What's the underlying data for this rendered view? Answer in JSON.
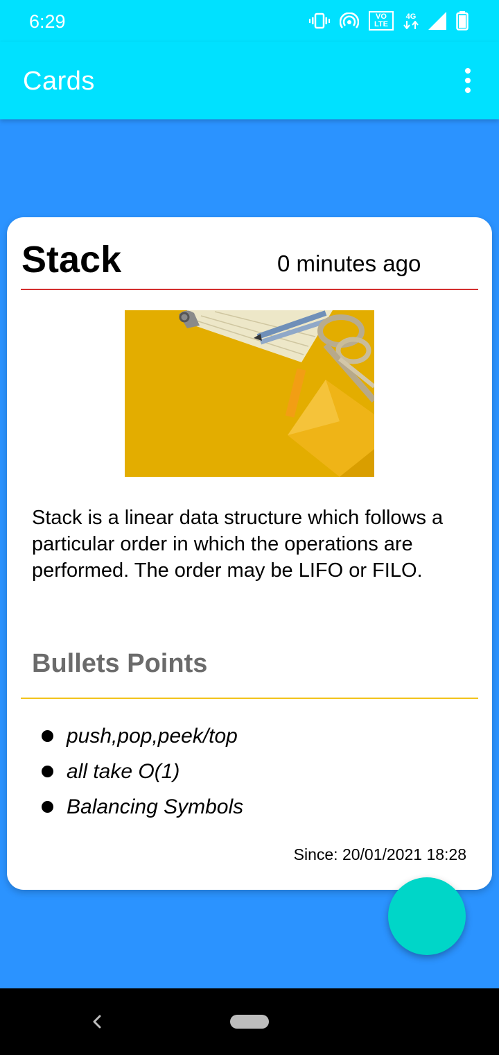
{
  "status_bar": {
    "time": "6:29",
    "lte_top": "VO",
    "lte_bottom": "LTE",
    "network": "4G",
    "icons": [
      "vibrate-icon",
      "hotspot-icon",
      "volte-icon",
      "network-4g-icon",
      "signal-icon",
      "battery-icon"
    ]
  },
  "app_bar": {
    "title": "Cards",
    "menu_icon": "more-vert-icon"
  },
  "card": {
    "title": "Stack",
    "time_ago": "0 minutes ago",
    "description": "Stack is a linear data structure which follows a particular order in which the operations are performed. The order may be LIFO or FILO.",
    "bullets_heading": "Bullets Points",
    "bullets": [
      "push,pop,peek/top",
      "all take O(1)",
      "Balancing Symbols"
    ],
    "since": "Since: 20/01/2021 18:28"
  },
  "colors": {
    "app_bar": "#00E1FF",
    "background": "#2B93FF",
    "fab": "#00D6C8",
    "title_divider": "#D32F2F",
    "bullets_divider": "#F2C31C",
    "bullets_heading": "#6B6B6B"
  },
  "nav_bar": {
    "icons": [
      "back-icon",
      "home-pill-icon"
    ]
  }
}
